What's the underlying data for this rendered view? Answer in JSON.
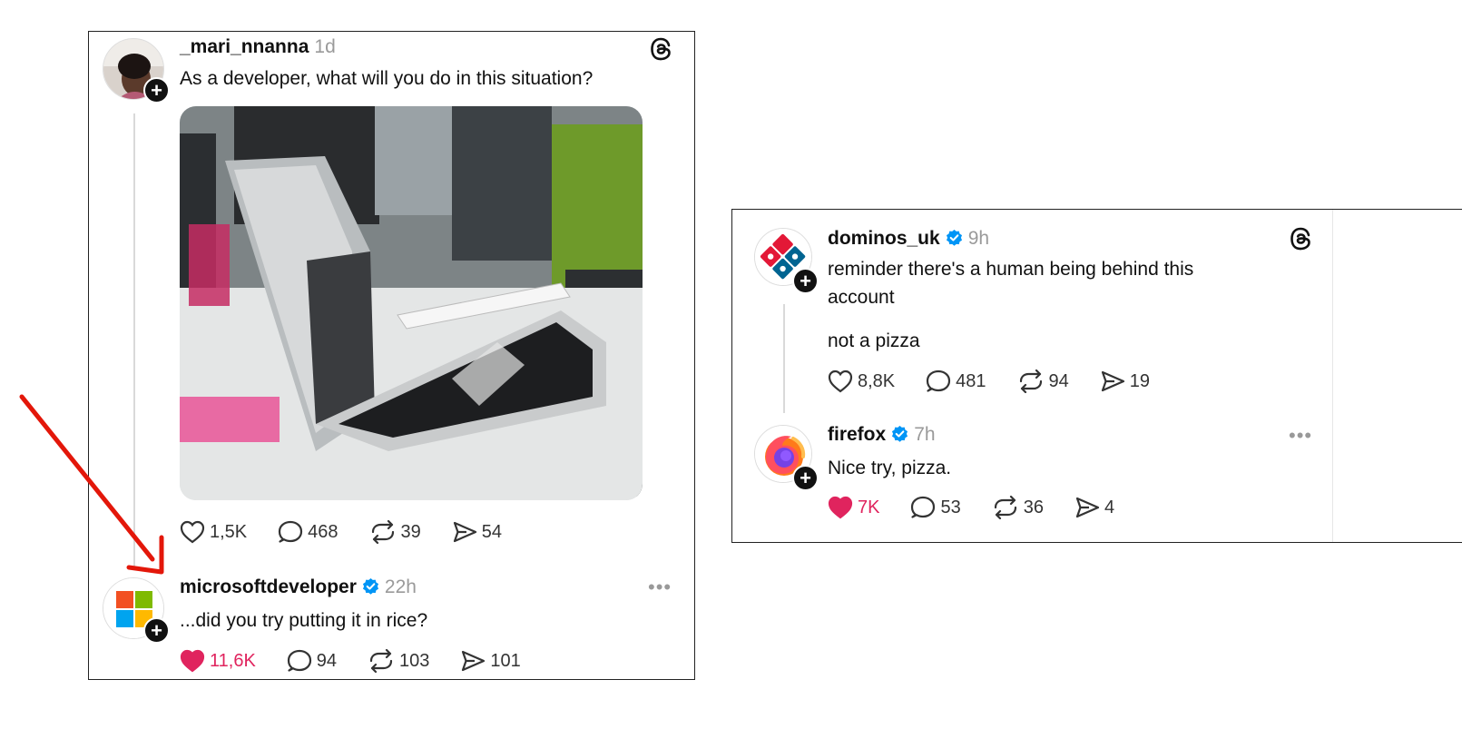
{
  "left_panel": {
    "post": {
      "username": "_mari_nnanna",
      "time": "1d",
      "text": "As a developer, what will you do in this situation?",
      "likes": "1,5K",
      "replies": "468",
      "reposts": "39",
      "shares": "54",
      "liked": false
    },
    "reply": {
      "username": "microsoftdeveloper",
      "time": "22h",
      "verified": true,
      "text": "...did you try putting it in rice?",
      "likes": "11,6K",
      "replies": "94",
      "reposts": "103",
      "shares": "101",
      "liked": true
    }
  },
  "right_panel": {
    "post": {
      "username": "dominos_uk",
      "time": "9h",
      "verified": true,
      "text_line1": "reminder there's a human being behind this",
      "text_line2": "account",
      "text_para2": "not a pizza",
      "likes": "8,8K",
      "replies": "481",
      "reposts": "94",
      "shares": "19",
      "liked": false
    },
    "reply": {
      "username": "firefox",
      "time": "7h",
      "verified": true,
      "text": "Nice try, pizza.",
      "likes": "7K",
      "replies": "53",
      "reposts": "36",
      "shares": "4",
      "liked": true
    }
  },
  "colors": {
    "like_active": "#e0245e",
    "verified_blue": "#0095f6",
    "annotation_arrow": "#e3170a"
  },
  "icons": [
    "threads-logo-icon",
    "heart-icon",
    "reply-icon",
    "repost-icon",
    "share-icon",
    "verified-icon",
    "follow-plus-icon",
    "more-icon",
    "red-arrow-annotation"
  ]
}
